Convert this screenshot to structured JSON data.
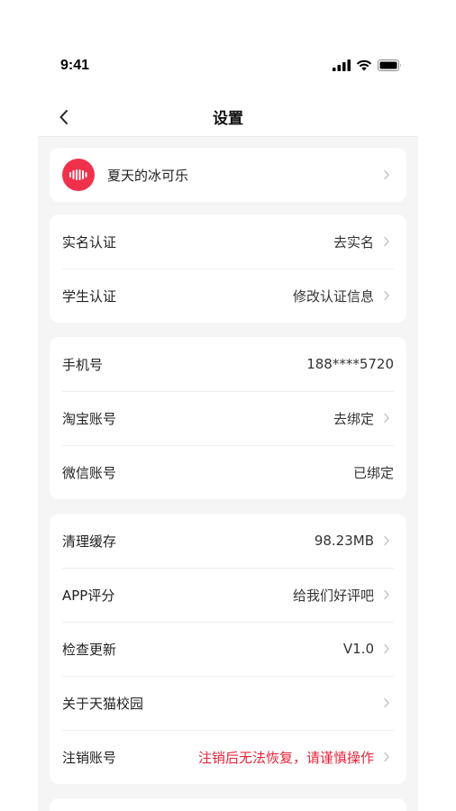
{
  "status": {
    "time": "9:41"
  },
  "nav": {
    "title": "设置"
  },
  "profile": {
    "name": "夏天的冰可乐"
  },
  "groups": [
    {
      "items": [
        {
          "label": "实名认证",
          "value": "去实名"
        },
        {
          "label": "学生认证",
          "value": "修改认证信息"
        }
      ]
    },
    {
      "items": [
        {
          "label": "手机号",
          "value": "188****5720"
        },
        {
          "label": "淘宝账号",
          "value": "去绑定"
        },
        {
          "label": "微信账号",
          "value": "已绑定"
        }
      ]
    },
    {
      "items": [
        {
          "label": "清理缓存",
          "value": "98.23MB"
        },
        {
          "label": "APP评分",
          "value": "给我们好评吧"
        },
        {
          "label": "检查更新",
          "value": "V1.0"
        },
        {
          "label": "关于天猫校园",
          "value": ""
        },
        {
          "label": "注销账号",
          "value": "注销后无法恢复，请谨慎操作"
        }
      ]
    }
  ],
  "colors": {
    "accent": "#f0314b",
    "warning": "#e8243b",
    "background": "#f5f5f5"
  },
  "icons": [
    "back-arrow-icon",
    "signal-icon",
    "wifi-icon",
    "battery-icon",
    "chevron-right-icon",
    "avatar-logo-icon"
  ]
}
